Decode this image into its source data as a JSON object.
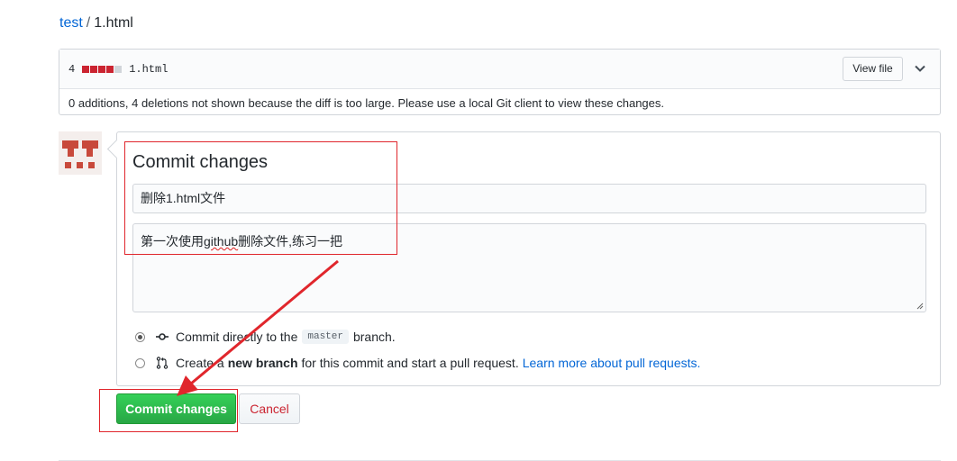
{
  "breadcrumb": {
    "repo": "test",
    "separator": "/",
    "file": "1.html"
  },
  "file_header": {
    "diff_count": "4",
    "diffstat_blocks": [
      {
        "kind": "deleted",
        "color": "#cb2431"
      },
      {
        "kind": "deleted",
        "color": "#cb2431"
      },
      {
        "kind": "deleted",
        "color": "#cb2431"
      },
      {
        "kind": "deleted",
        "color": "#cb2431"
      },
      {
        "kind": "neutral",
        "color": "#d1d5da"
      }
    ],
    "filename": "1.html",
    "view_file_label": "View file",
    "expand_icon": "chevron-down-icon",
    "note": "0 additions, 4 deletions not shown because the diff is too large. Please use a local Git client to view these changes."
  },
  "commit_form": {
    "title": "Commit changes",
    "summary_value": "删除1.html文件",
    "description_before": "第一次使用",
    "description_misspelled": "github",
    "description_after": "删除文件,练习一把",
    "option_direct": {
      "prefix": "Commit directly to the",
      "branch": "master",
      "suffix": "branch.",
      "icon": "git-commit-icon",
      "selected": true
    },
    "option_new_branch": {
      "prefix": "Create a",
      "bold": "new branch",
      "suffix": "for this commit and start a pull request.",
      "link": "Learn more about pull requests.",
      "icon": "git-pull-request-icon",
      "selected": false
    }
  },
  "buttons": {
    "commit_label": "Commit changes",
    "cancel_label": "Cancel"
  },
  "colors": {
    "link": "#0366d6",
    "commit_green": "#28a745",
    "cancel_red": "#cb2431",
    "annotation_red": "#e0262c",
    "avatar": "#c8493b"
  }
}
